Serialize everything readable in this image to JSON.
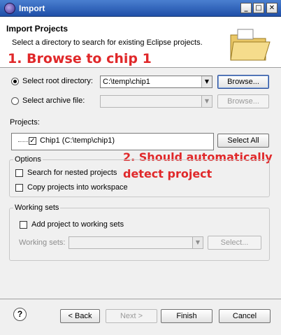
{
  "window": {
    "title": "Import"
  },
  "header": {
    "heading": "Import Projects",
    "description": "Select a directory to search for existing Eclipse projects."
  },
  "annotations": {
    "step1": "1. Browse to chip 1",
    "step2_line1": "2. Should automatically",
    "step2_line2": "detect project"
  },
  "source": {
    "root_dir_label": "Select root directory:",
    "root_dir_value": "C:\\temp\\chip1",
    "archive_label": "Select archive file:",
    "archive_value": "",
    "browse_label": "Browse...",
    "browse_archive_label": "Browse...",
    "selected": "root_directory"
  },
  "projects": {
    "label": "Projects:",
    "items": [
      {
        "label": "Chip1 (C:\\temp\\chip1)",
        "checked": true
      }
    ],
    "select_all_label": "Select All"
  },
  "options": {
    "title": "Options",
    "search_nested_label": "Search for nested projects",
    "search_nested_checked": false,
    "copy_projects_label": "Copy projects into workspace",
    "copy_projects_checked": false
  },
  "working_sets": {
    "title": "Working sets",
    "add_label": "Add project to working sets",
    "add_checked": false,
    "sets_label": "Working sets:",
    "sets_value": "",
    "select_label": "Select..."
  },
  "footer": {
    "help_icon": "?",
    "back_label": "< Back",
    "next_label": "Next >",
    "finish_label": "Finish",
    "cancel_label": "Cancel"
  },
  "colors": {
    "titlebar": "#1f4fa8",
    "annotation": "#e0282a",
    "dialog_bg": "#f0f0f0"
  },
  "icons": {
    "app": "eclipse-icon",
    "header": "folder-icon",
    "minimize": "minimize-icon",
    "maximize": "maximize-icon",
    "close": "close-icon",
    "help": "help-icon"
  }
}
